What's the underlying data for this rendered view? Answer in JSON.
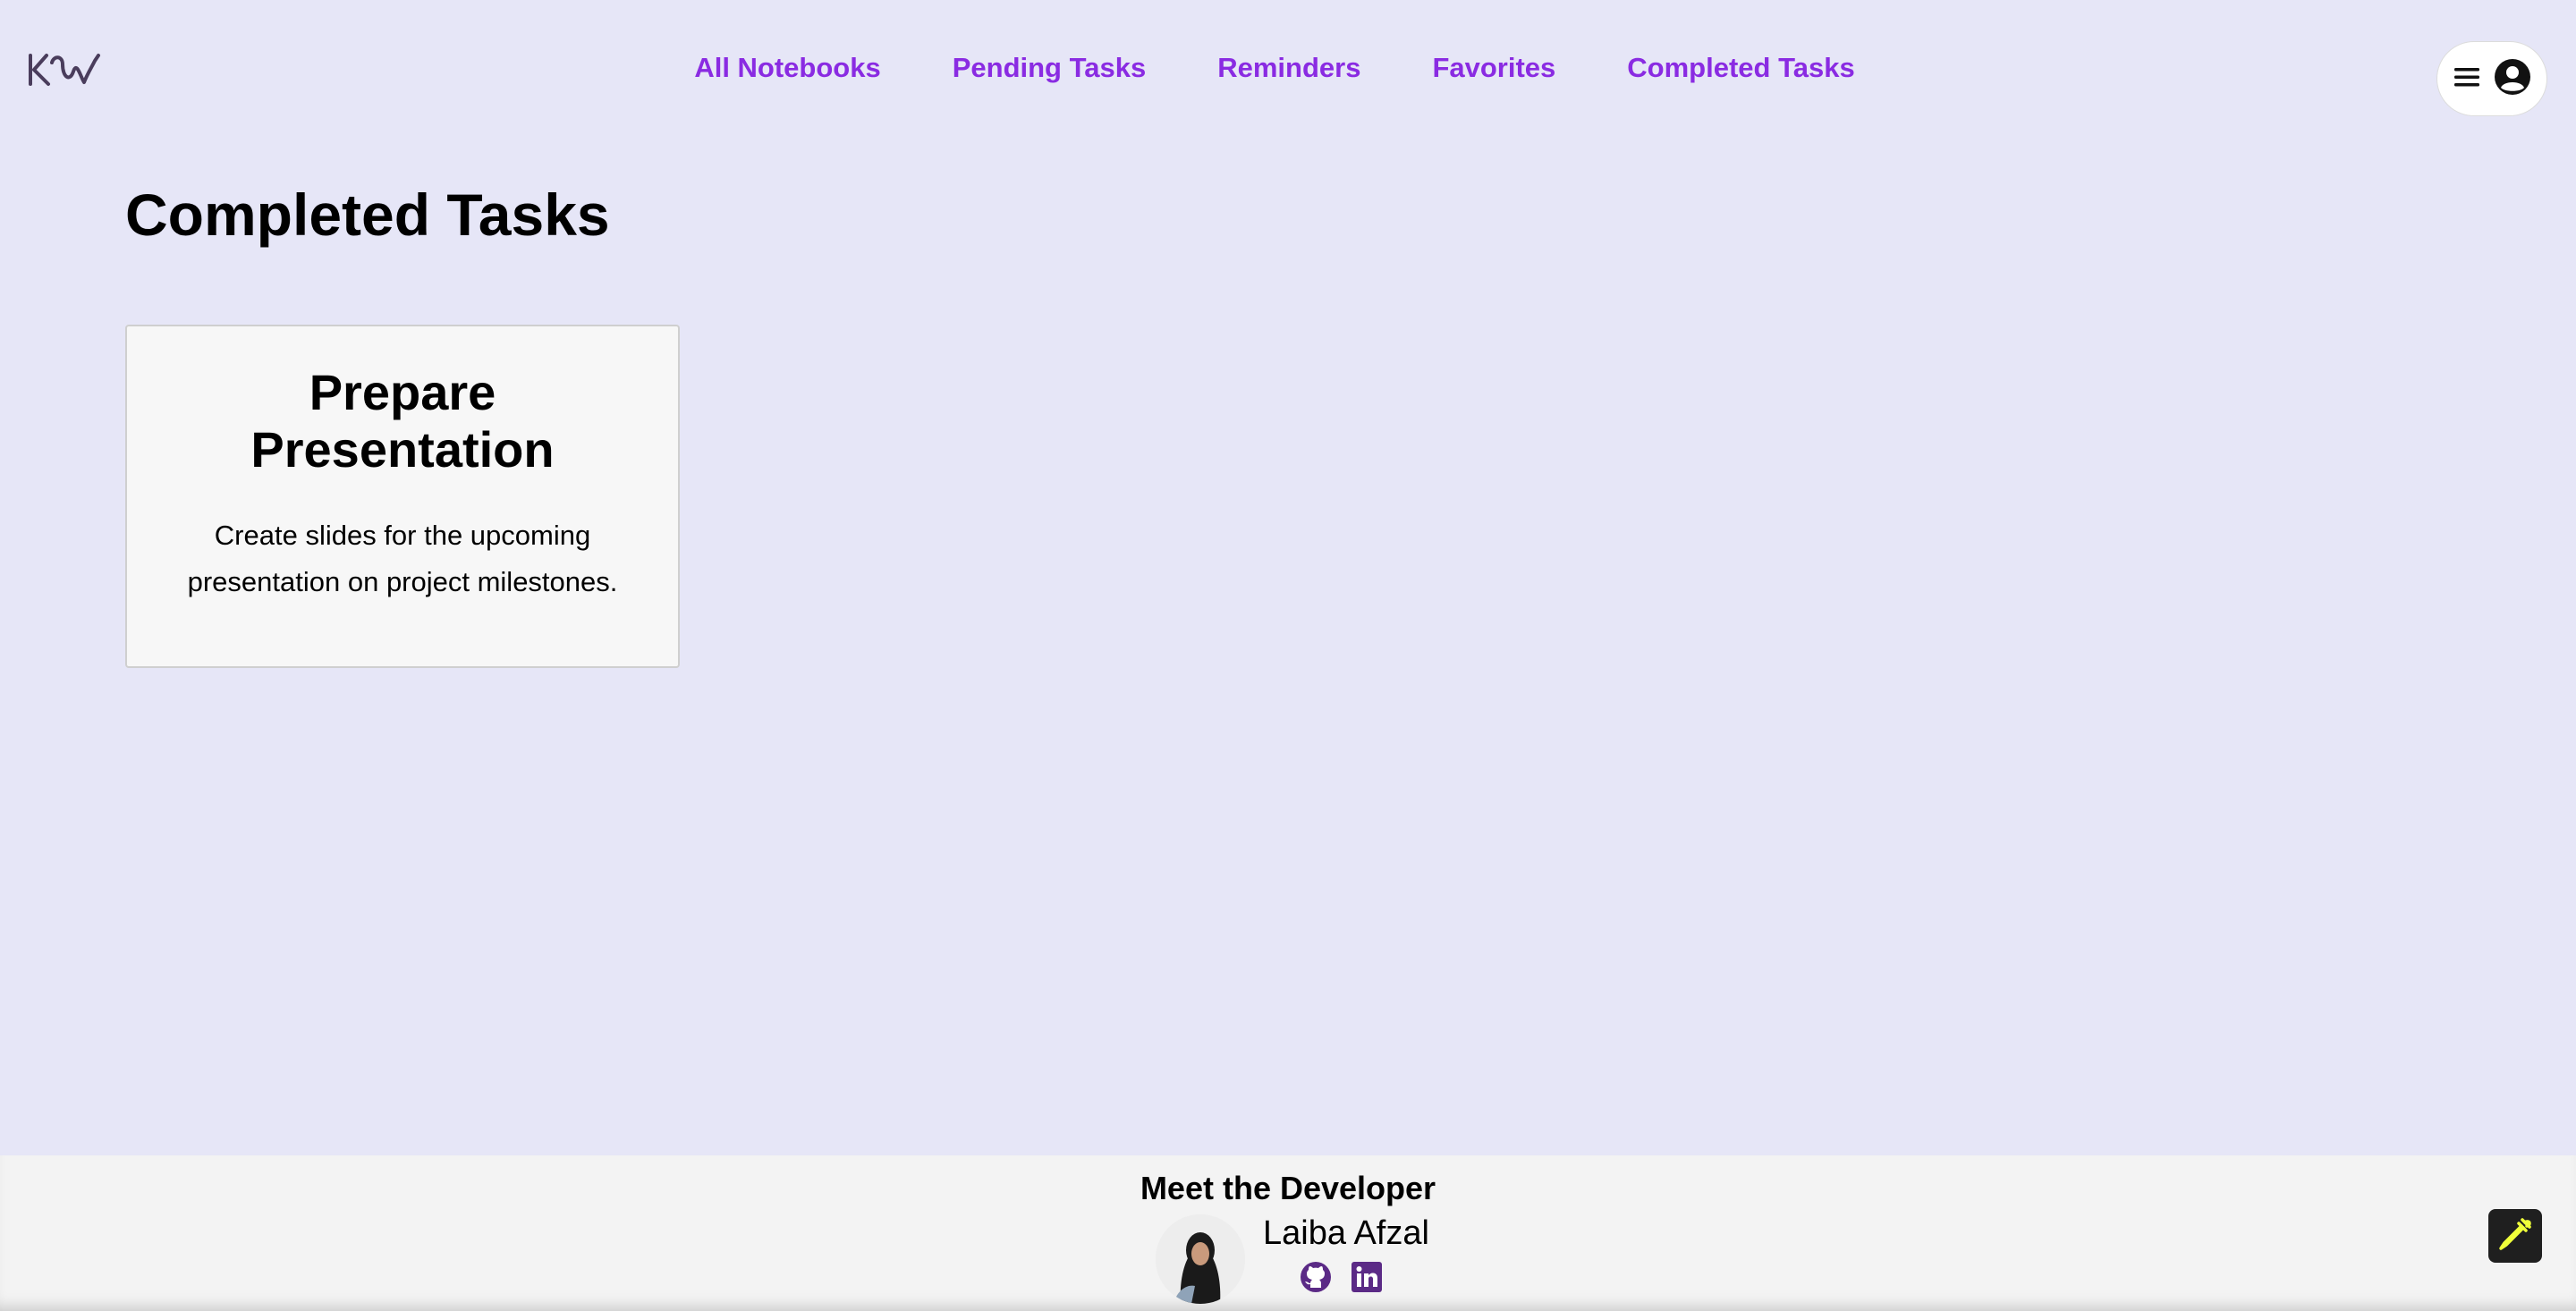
{
  "header": {
    "logo_alt": "logo",
    "nav": [
      {
        "label": "All Notebooks"
      },
      {
        "label": "Pending Tasks"
      },
      {
        "label": "Reminders"
      },
      {
        "label": "Favorites"
      },
      {
        "label": "Completed Tasks"
      }
    ],
    "user_menu": {
      "menu_icon": "hamburger-menu-icon",
      "avatar_icon": "user-circle-icon"
    }
  },
  "main": {
    "title": "Completed Tasks",
    "cards": [
      {
        "title": "Prepare Presentation",
        "description": "Create slides for the upcoming presentation on project milestones."
      }
    ]
  },
  "footer": {
    "title": "Meet the Developer",
    "developer_name": "Laiba Afzal",
    "links": [
      {
        "icon": "github-icon"
      },
      {
        "icon": "linkedin-icon"
      }
    ]
  },
  "colors": {
    "background": "#e6e6f7",
    "nav_link": "#8a2be2",
    "footer_bg": "#f3f3f3",
    "social_icon": "#5b2a86",
    "fab_bg": "#1f1f1f",
    "fab_icon": "#f0ff3a"
  }
}
